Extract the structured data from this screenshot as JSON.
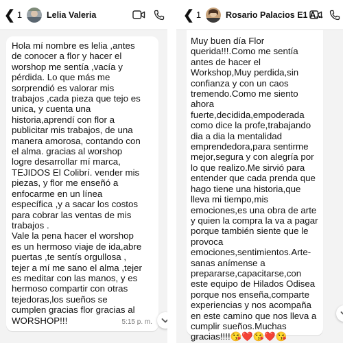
{
  "left_chat": {
    "back_count": "1",
    "contact_name": "Lelia Valeria",
    "message": {
      "text": "Hola mí nombre es lelia ,antes\nde conocer a flor y hacer el\nworshop me sentía ,vacía y\npérdida. Lo que más me\nsorprendió es valorar mis\ntrabajos ,cada pieza que tejo es\nunica, y cuenta una\nhistoria,aprendí con flor a\npublicitar mis trabajos, de una\nmanera amorosa, contando con\nel alma. gracias al worshop\nlogre desarrollar mí marca,\nTEJIDOS El Colibrí. vender mis\npiezas, y flor me enseñó a\nenfocarme en un línea\nespecífica ,y a sacar los costos\npara cobrar las ventas de mis\ntrabajos .\nVale la pena hacer el worshop\nes un hermoso viaje de ida,abre\npuertas ,te sentís orgullosa ,\ntejer a mí me sano el alma ,tejer\nes meditar con las manos, y es\nhermoso compartir con otras\ntejedoras,los sueños se\ncumplen gracias flor gracias al\nWORSHOP!!!",
      "time": "5:15 p. m."
    }
  },
  "right_chat": {
    "back_count": "1",
    "contact_name": "Rosario Palacios E1 A...",
    "message": {
      "text": "Muy buen día Flor\nquerida!!!.Como me sentía\nantes de hacer el\nWorkshop,Muy perdida,sin\nconfianza y con un caos\ntremendo.Como me siento\nahora\nfuerte,decidida,empoderada\ncomo dice la profe,trabajando\ndia a dia la mentalidad\nemprendedora,para sentirme\nmejor,segura y con alegría por\nlo que realizo.Me sirvió para\nentender que cada prenda que\nhago tiene una historia,que\nlleva mi tiempo,mis\nemociones,es una obra de arte\ny quien la compra la va a pagar\nporque también siente que le\nprovoca\nemociones,sentimientos.Arte-\nsanas anímense a\nprepararse,capacitarse,con\neste equipo de Hilados Odisea\nporque nos enseña,comparte\nexperiencias y nos acompaña\nen este camino que nos lleva a\ncumplir sueños.Muchas\ngracias!!!!😘❤️😘❤️😘"
    }
  },
  "icons": {
    "back": "chevron-left-icon",
    "video": "video-camera-icon",
    "call": "phone-icon",
    "scroll": "chevron-down-icon"
  },
  "colors": {
    "background": "#f3f3f3",
    "bubble": "#ffffff",
    "text": "#111111",
    "timestamp": "#777777"
  }
}
